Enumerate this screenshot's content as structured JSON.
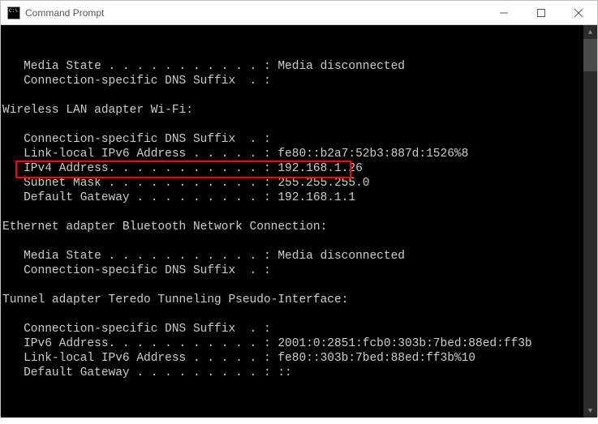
{
  "window": {
    "title": "Command Prompt"
  },
  "terminal": {
    "lines": [
      "   Media State . . . . . . . . . . . : Media disconnected",
      "   Connection-specific DNS Suffix  . :",
      "",
      "Wireless LAN adapter Wi-Fi:",
      "",
      "   Connection-specific DNS Suffix  . :",
      "   Link-local IPv6 Address . . . . . : fe80::b2a7:52b3:887d:1526%8",
      "   IPv4 Address. . . . . . . . . . . : 192.168.1.26",
      "   Subnet Mask . . . . . . . . . . . : 255.255.255.0",
      "   Default Gateway . . . . . . . . . : 192.168.1.1",
      "",
      "Ethernet adapter Bluetooth Network Connection:",
      "",
      "   Media State . . . . . . . . . . . : Media disconnected",
      "   Connection-specific DNS Suffix  . :",
      "",
      "Tunnel adapter Teredo Tunneling Pseudo-Interface:",
      "",
      "   Connection-specific DNS Suffix  . :",
      "   IPv6 Address. . . . . . . . . . . : 2001:0:2851:fcb0:303b:7bed:88ed:ff3b",
      "   Link-local IPv6 Address . . . . . : fe80::303b:7bed:88ed:ff3b%10",
      "   Default Gateway . . . . . . . . . : ::"
    ]
  }
}
